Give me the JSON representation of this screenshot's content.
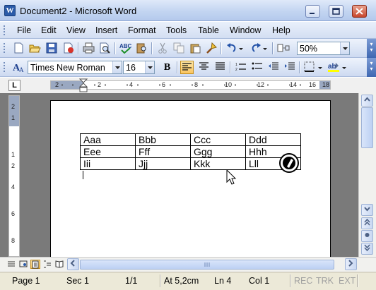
{
  "window": {
    "title": "Document2 - Microsoft Word"
  },
  "menu": {
    "items": [
      {
        "label": "File"
      },
      {
        "label": "Edit"
      },
      {
        "label": "View"
      },
      {
        "label": "Insert"
      },
      {
        "label": "Format"
      },
      {
        "label": "Tools"
      },
      {
        "label": "Table"
      },
      {
        "label": "Window"
      },
      {
        "label": "Help"
      }
    ]
  },
  "toolbar": {
    "zoom": "50%"
  },
  "formatting": {
    "font": "Times New Roman",
    "size": "16"
  },
  "ruler": {
    "labels": [
      "2",
      "2",
      "4",
      "6",
      "8",
      "10",
      "12",
      "14",
      "16",
      "18"
    ]
  },
  "vruler": {
    "labels": [
      "2",
      "1",
      "1",
      "2",
      "4",
      "6",
      "8"
    ]
  },
  "table": {
    "rows": [
      [
        "Aaa",
        "Bbb",
        "Ccc",
        "Ddd"
      ],
      [
        "Eee",
        "Fff",
        "Ggg",
        "Hhh"
      ],
      [
        "Iii",
        "Jjj",
        "Kkk",
        "Lll"
      ]
    ]
  },
  "status": {
    "page": "Page 1",
    "section": "Sec 1",
    "pages": "1/1",
    "at": "At 5,2cm",
    "line": "Ln 4",
    "col": "Col 1",
    "rec": "REC",
    "trk": "TRK",
    "ext": "EXT"
  }
}
